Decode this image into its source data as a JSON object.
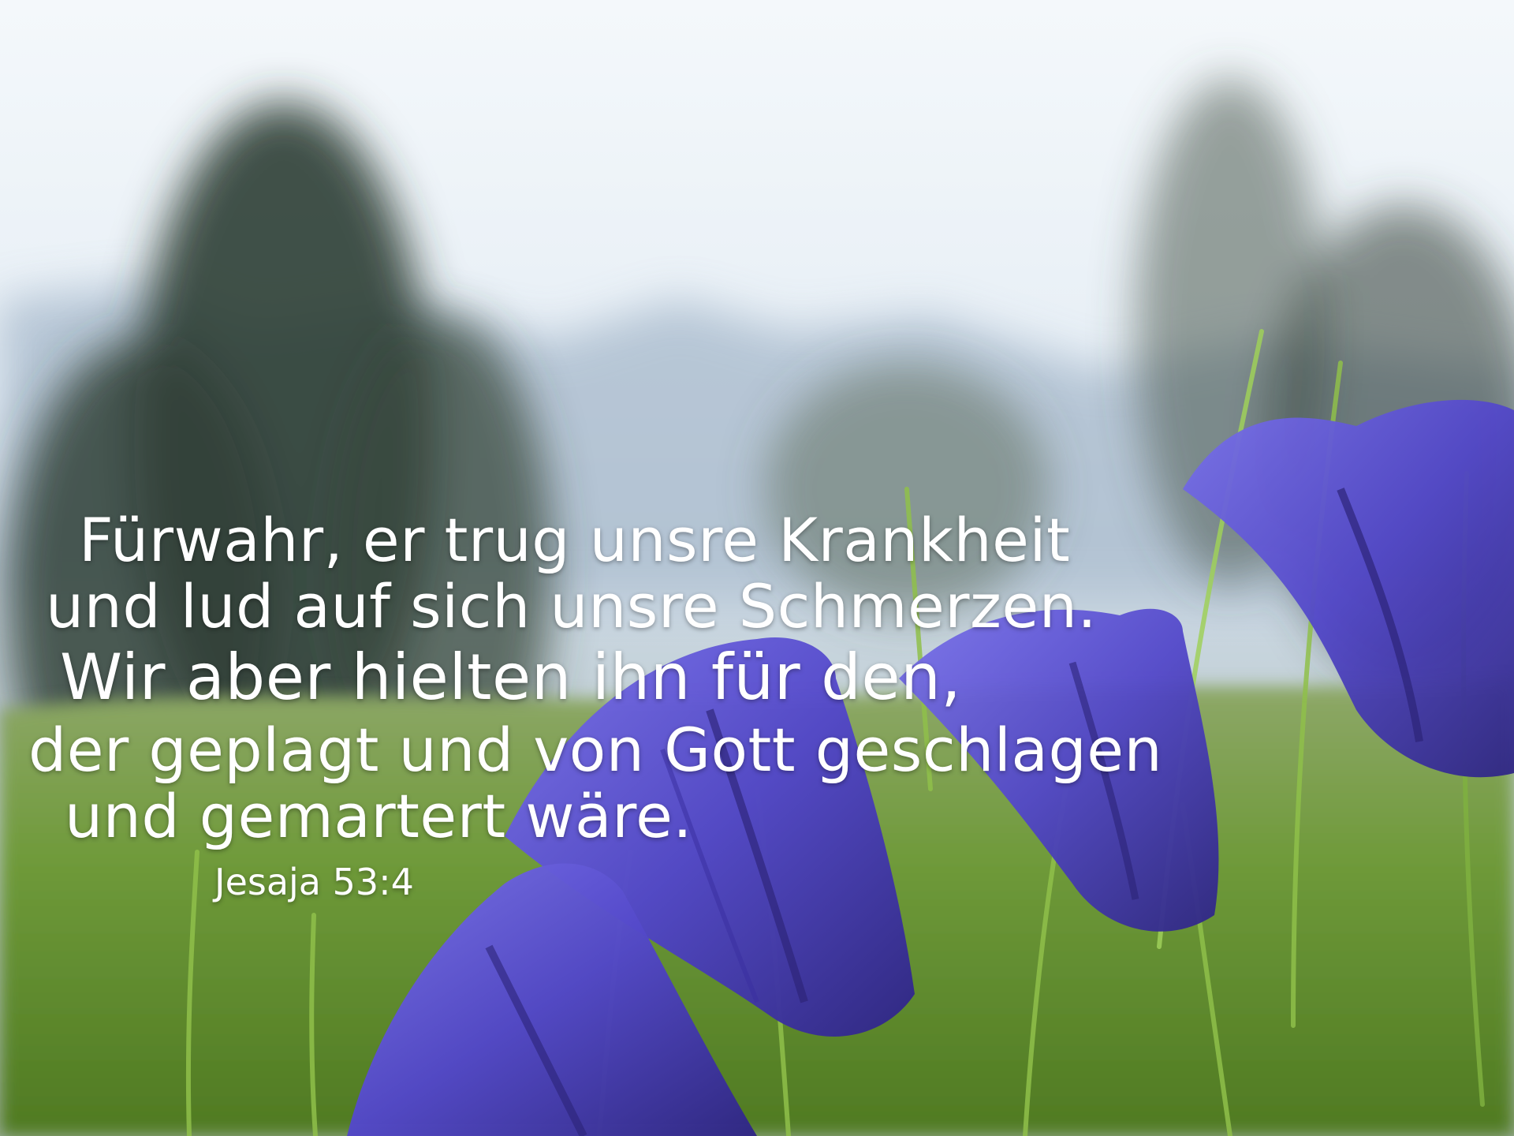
{
  "verse": {
    "lines": [
      "Fürwahr, er trug unsre Krankheit",
      "und lud auf sich unsre Schmerzen.",
      "Wir aber hielten ihn für den,",
      "der geplagt und von Gott geschlagen",
      "und gemartert wäre."
    ],
    "reference": "Jesaja 53:4"
  },
  "palette": {
    "sky": "#e9f1f8",
    "mountain": "#aebfd0",
    "tree": "#2f3d34",
    "grass": "#5e8a2e",
    "flower": "#5a4fd1",
    "flower_dark": "#2c2377",
    "text": "#ffffff"
  }
}
